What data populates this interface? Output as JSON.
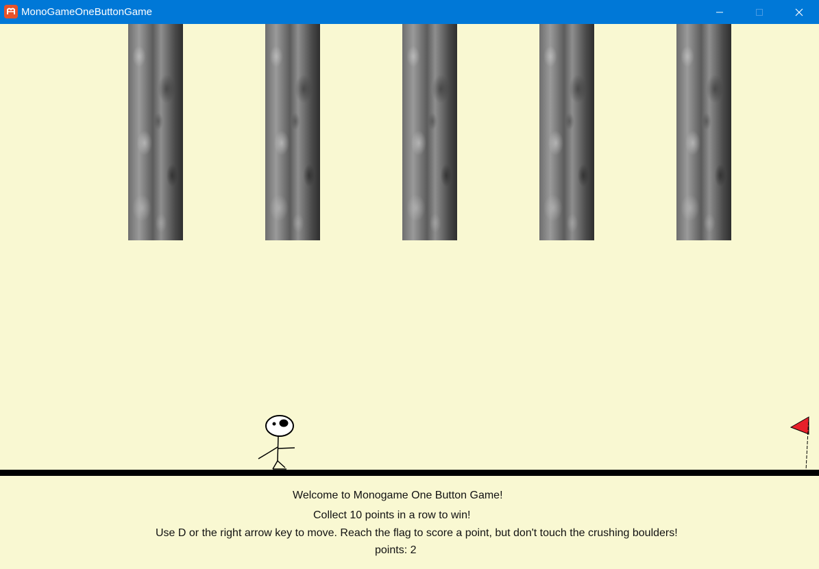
{
  "window": {
    "title": "MonoGameOneButtonGame",
    "icon": "monogame-logo-icon",
    "controls": {
      "minimize_icon": "minimize-icon",
      "maximize_icon": "maximize-icon",
      "close_icon": "close-icon"
    }
  },
  "game": {
    "background_color": "#F9F8D2",
    "boulder_count": 5,
    "ground_color": "#000000",
    "flag_color": "#E8202A",
    "messages": {
      "welcome": "Welcome to Monogame One Button Game!",
      "goal": "Collect 10 points in a row to win!",
      "instructions": "Use D or the right arrow key to move. Reach the flag to score a point, but don't touch the crushing boulders!",
      "points_label": "points:",
      "points_value": "2"
    }
  }
}
